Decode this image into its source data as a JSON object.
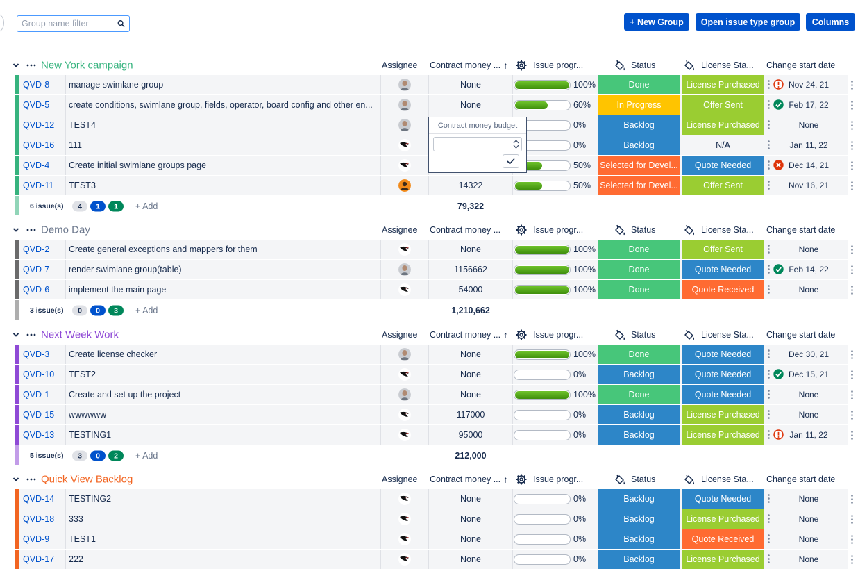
{
  "filter": {
    "placeholder": "Group name filter"
  },
  "toolbar": {
    "new_group_label": "+ New Group",
    "open_issue_type_group_label": "Open issue type group",
    "columns_label": "Columns"
  },
  "columns": {
    "assignee": "Assignee",
    "contract_money": "Contract money ...",
    "issue_progress": "Issue progr...",
    "status": "Status",
    "license_status": "License Sta...",
    "change_start_date": "Change start date"
  },
  "colors": {
    "done": "#47c67a",
    "in_progress": "#ffc400",
    "backlog": "#2d86c8",
    "selected": "#ff6b32",
    "license_purchased": "#9acd32",
    "offer_sent": "#9acd32",
    "quote_needed": "#2d86c8",
    "quote_received": "#ff6b32",
    "na": "#f4f5f7"
  },
  "groups": [
    {
      "name": "New York campaign",
      "color": "#36b37e",
      "name_color": "#36b37e",
      "sort_arrow": "↑",
      "rows": [
        {
          "key": "QVD-8",
          "summary": "manage swimlane group",
          "avatar": "person",
          "money": "None",
          "progress": 100,
          "pct": "100%",
          "status": "Done",
          "status_kind": "done",
          "license": "License Purchased",
          "license_kind": "license_purchased",
          "marker": "warning",
          "date": "Nov 24, 21"
        },
        {
          "key": "QVD-5",
          "summary": "create conditions, swimlane group, fields, operator, board config and other en...",
          "avatar": "person",
          "money": "None",
          "progress": 60,
          "pct": "60%",
          "status": "In Progress",
          "status_kind": "in_progress",
          "license": "Offer Sent",
          "license_kind": "offer_sent",
          "marker": "check",
          "date": "Feb 17, 22"
        },
        {
          "key": "QVD-12",
          "summary": "TEST4",
          "avatar": "person",
          "money": "",
          "progress": 0,
          "pct": "0%",
          "status": "Backlog",
          "status_kind": "backlog",
          "license": "License Purchased",
          "license_kind": "license_purchased",
          "marker": "",
          "date": "None"
        },
        {
          "key": "QVD-16",
          "summary": "111",
          "avatar": "bird",
          "money": "",
          "progress": 0,
          "pct": "0%",
          "status": "Backlog",
          "status_kind": "backlog",
          "license": "N/A",
          "license_kind": "na",
          "marker": "",
          "date": "Jan 11, 22"
        },
        {
          "key": "QVD-4",
          "summary": "Create initial swimlane groups page",
          "avatar": "bird",
          "money": "",
          "progress": 50,
          "pct": "50%",
          "status": "Selected for Devel...",
          "status_kind": "selected",
          "license": "Quote Needed",
          "license_kind": "quote_needed",
          "marker": "error",
          "date": "Dec 14, 21"
        },
        {
          "key": "QVD-11",
          "summary": "TEST3",
          "avatar": "orange",
          "money": "14322",
          "progress": 50,
          "pct": "50%",
          "status": "Selected for Devel...",
          "status_kind": "selected",
          "license": "Offer Sent",
          "license_kind": "offer_sent",
          "marker": "",
          "date": "Nov 16, 21"
        }
      ],
      "issue_count": "6 issue(s)",
      "counts": [
        "4",
        "1",
        "1"
      ],
      "add_label": "+ Add",
      "total": "79,322"
    },
    {
      "name": "Demo Day",
      "color": "#6b6b6b",
      "name_color": "#6b778c",
      "sort_arrow": "",
      "rows": [
        {
          "key": "QVD-2",
          "summary": "Create general exceptions and mappers for them",
          "avatar": "bird",
          "money": "None",
          "progress": 100,
          "pct": "100%",
          "status": "Done",
          "status_kind": "done",
          "license": "Offer Sent",
          "license_kind": "offer_sent",
          "marker": "",
          "date": "None"
        },
        {
          "key": "QVD-7",
          "summary": "render swimlane group(table)",
          "avatar": "person",
          "money": "1156662",
          "progress": 100,
          "pct": "100%",
          "status": "Done",
          "status_kind": "done",
          "license": "Quote Needed",
          "license_kind": "quote_needed",
          "marker": "check",
          "date": "Feb 14, 22"
        },
        {
          "key": "QVD-6",
          "summary": "implement the main page",
          "avatar": "bird",
          "money": "54000",
          "progress": 100,
          "pct": "100%",
          "status": "Done",
          "status_kind": "done",
          "license": "Quote Received",
          "license_kind": "quote_received",
          "marker": "",
          "date": "None"
        }
      ],
      "issue_count": "3 issue(s)",
      "counts": [
        "0",
        "0",
        "3"
      ],
      "add_label": "+ Add",
      "total": "1,210,662"
    },
    {
      "name": "Next Week Work",
      "color": "#8f4ad6",
      "name_color": "#8f4ad6",
      "sort_arrow": "↑",
      "rows": [
        {
          "key": "QVD-3",
          "summary": "Create license checker",
          "avatar": "person",
          "money": "None",
          "progress": 100,
          "pct": "100%",
          "status": "Done",
          "status_kind": "done",
          "license": "Quote Needed",
          "license_kind": "quote_needed",
          "marker": "",
          "date": "Dec 30, 21"
        },
        {
          "key": "QVD-10",
          "summary": "TEST2",
          "avatar": "bird",
          "money": "None",
          "progress": 0,
          "pct": "0%",
          "status": "Backlog",
          "status_kind": "backlog",
          "license": "Quote Needed",
          "license_kind": "quote_needed",
          "marker": "check",
          "date": "Dec 15, 21"
        },
        {
          "key": "QVD-1",
          "summary": "Create and set up the project",
          "avatar": "person",
          "money": "None",
          "progress": 100,
          "pct": "100%",
          "status": "Done",
          "status_kind": "done",
          "license": "Quote Needed",
          "license_kind": "quote_needed",
          "marker": "",
          "date": "None"
        },
        {
          "key": "QVD-15",
          "summary": "wwwwww",
          "avatar": "bird",
          "money": "117000",
          "progress": 0,
          "pct": "0%",
          "status": "Backlog",
          "status_kind": "backlog",
          "license": "License Purchased",
          "license_kind": "license_purchased",
          "marker": "",
          "date": "None"
        },
        {
          "key": "QVD-13",
          "summary": "TESTING1",
          "avatar": "bird",
          "money": "95000",
          "progress": 0,
          "pct": "0%",
          "status": "Backlog",
          "status_kind": "backlog",
          "license": "License Purchased",
          "license_kind": "license_purchased",
          "marker": "warning",
          "date": "Jan 11, 22"
        }
      ],
      "issue_count": "5 issue(s)",
      "counts": [
        "3",
        "0",
        "2"
      ],
      "add_label": "+ Add",
      "total": "212,000"
    },
    {
      "name": "Quick View Backlog",
      "color": "#f26522",
      "name_color": "#f26522",
      "sort_arrow": "↑",
      "rows": [
        {
          "key": "QVD-14",
          "summary": "TESTING2",
          "avatar": "bird",
          "money": "None",
          "progress": 0,
          "pct": "0%",
          "status": "Backlog",
          "status_kind": "backlog",
          "license": "Quote Needed",
          "license_kind": "quote_needed",
          "marker": "",
          "date": "None"
        },
        {
          "key": "QVD-18",
          "summary": "333",
          "avatar": "bird",
          "money": "None",
          "progress": 0,
          "pct": "0%",
          "status": "Backlog",
          "status_kind": "backlog",
          "license": "License Purchased",
          "license_kind": "license_purchased",
          "marker": "",
          "date": "None"
        },
        {
          "key": "QVD-9",
          "summary": "TEST1",
          "avatar": "bird",
          "money": "None",
          "progress": 0,
          "pct": "0%",
          "status": "Backlog",
          "status_kind": "backlog",
          "license": "Quote Received",
          "license_kind": "quote_received",
          "marker": "",
          "date": "None"
        },
        {
          "key": "QVD-17",
          "summary": "222",
          "avatar": "bird",
          "money": "None",
          "progress": 0,
          "pct": "0%",
          "status": "Backlog",
          "status_kind": "backlog",
          "license": "License Purchased",
          "license_kind": "license_purchased",
          "marker": "",
          "date": "None"
        }
      ]
    }
  ],
  "popup": {
    "title": "Contract money budget",
    "value": ""
  }
}
